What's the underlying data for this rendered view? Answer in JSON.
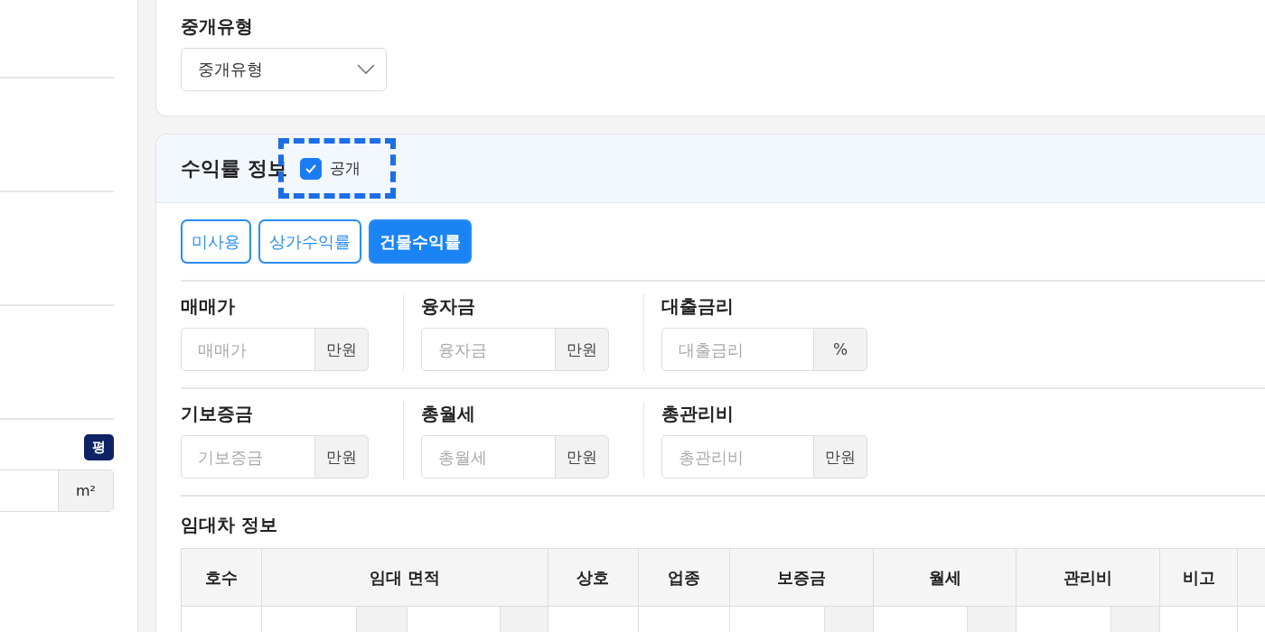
{
  "left_panel": {
    "unit_badge": "평",
    "area_unit": "m²"
  },
  "brokerage": {
    "label": "중개유형",
    "select_value": "중개유형"
  },
  "yield_section": {
    "title": "수익률 정보",
    "public": {
      "label": "공개",
      "checked": true
    },
    "modes": [
      {
        "label": "미사용",
        "selected": false
      },
      {
        "label": "상가수익률",
        "selected": false
      },
      {
        "label": "건물수익률",
        "selected": true
      }
    ],
    "field_rows": [
      {
        "fields": [
          {
            "label": "매매가",
            "placeholder": "매매가",
            "unit": "만원"
          },
          {
            "label": "융자금",
            "placeholder": "융자금",
            "unit": "만원"
          },
          {
            "label": "대출금리",
            "placeholder": "대출금리",
            "unit": "%"
          }
        ]
      },
      {
        "fields": [
          {
            "label": "기보증금",
            "placeholder": "기보증금",
            "unit": "만원"
          },
          {
            "label": "총월세",
            "placeholder": "총월세",
            "unit": "만원"
          },
          {
            "label": "총관리비",
            "placeholder": "총관리비",
            "unit": "만원"
          }
        ]
      }
    ],
    "lease": {
      "title": "임대차 정보",
      "columns": [
        "호수",
        "임대 면적",
        "상호",
        "업종",
        "보증금",
        "월세",
        "관리비",
        "비고"
      ]
    }
  }
}
